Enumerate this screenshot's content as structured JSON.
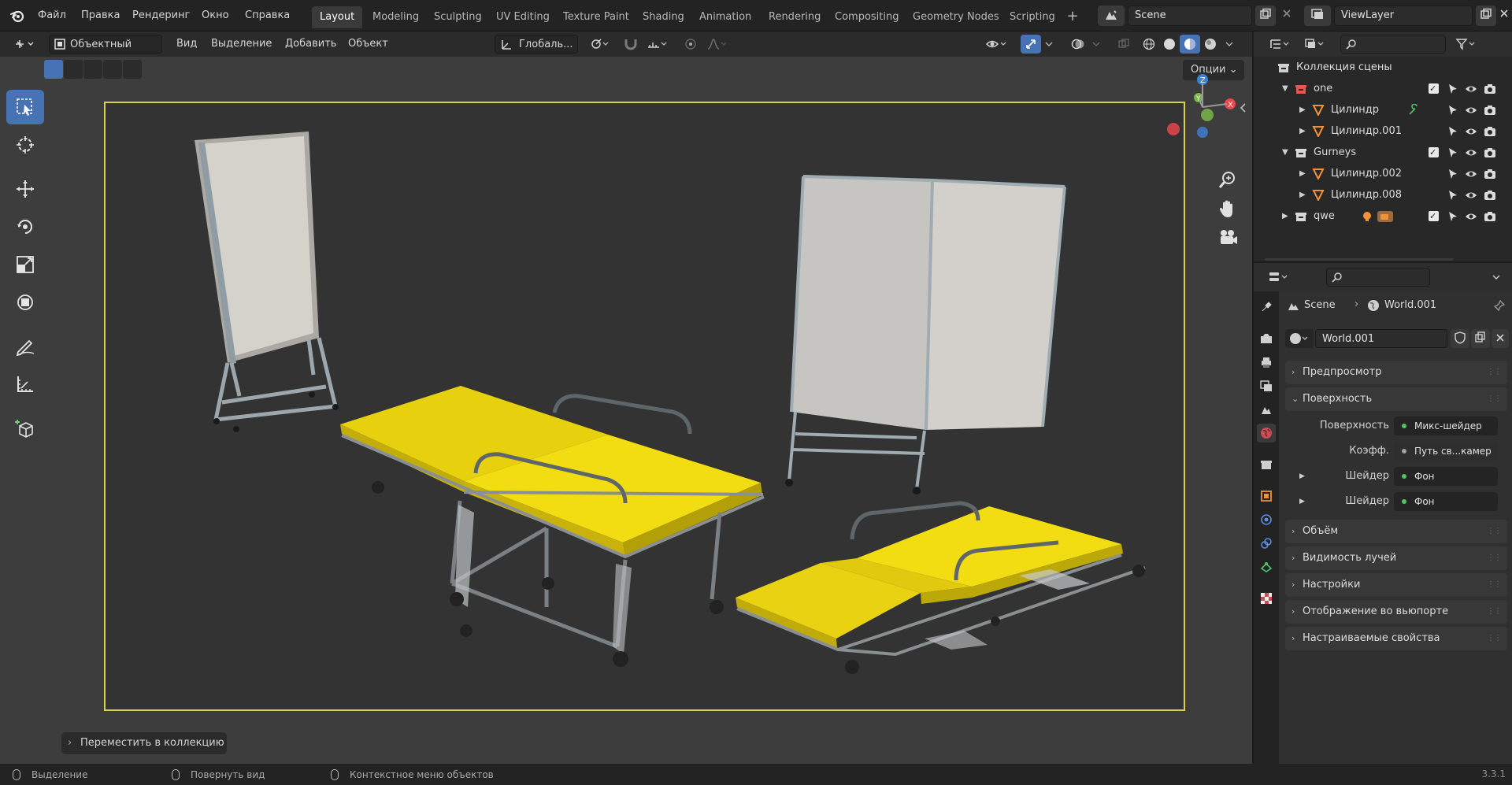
{
  "menu": [
    "Файл",
    "Правка",
    "Рендеринг",
    "Окно",
    "Справка"
  ],
  "workspaces": [
    "Layout",
    "Modeling",
    "Sculpting",
    "UV Editing",
    "Texture Paint",
    "Shading",
    "Animation",
    "Rendering",
    "Compositing",
    "Geometry Nodes",
    "Scripting"
  ],
  "active_workspace": "Layout",
  "scene_name": "Scene",
  "view_layer_name": "ViewLayer",
  "viewport_header": {
    "mode": "Объектный ре...",
    "view": "Вид",
    "select": "Выделение",
    "add": "Добавить",
    "object": "Объект",
    "orientation": "Глобаль...",
    "options": "Опции"
  },
  "redo_panel": "Переместить в коллекцию",
  "status": {
    "left": "Выделение",
    "mid": "Повернуть вид",
    "right": "Контекстное меню объектов",
    "version": "3.3.1"
  },
  "outliner": {
    "root": "Коллекция сцены",
    "rows": [
      {
        "label": "one",
        "type": "collection",
        "color": "#e8574f"
      },
      {
        "label": "Цилиндр",
        "type": "mesh"
      },
      {
        "label": "Цилиндр.001",
        "type": "mesh"
      },
      {
        "label": "Gurneys",
        "type": "collection",
        "color": "#d9d9d9"
      },
      {
        "label": "Цилиндр.002",
        "type": "mesh"
      },
      {
        "label": "Цилиндр.008",
        "type": "mesh"
      },
      {
        "label": "qwe",
        "type": "collection",
        "color": "#d9d9d9"
      }
    ]
  },
  "properties": {
    "breadcrumb_scene": "Scene",
    "breadcrumb_world": "World.001",
    "world_name": "World.001",
    "panels": {
      "preview": "Предпросмотр",
      "surface": "Поверхность",
      "volume": "Объём",
      "ray_visibility": "Видимость лучей",
      "settings": "Настройки",
      "viewport_display": "Отображение во вьюпорте",
      "custom_props": "Настраиваемые свойства"
    },
    "surface_rows": [
      {
        "key": "Поверхность",
        "value": "Микс-шейдер"
      },
      {
        "key": "Коэфф.",
        "value": "Путь св...камер"
      },
      {
        "key": "Шейдер",
        "value": "Фон"
      },
      {
        "key": "Шейдер",
        "value": "Фон"
      }
    ]
  },
  "colors": {
    "accent": "#4772b3",
    "camera_frame": "#d9d14a",
    "mattress": "#f2dc12",
    "x_axis": "#e8474b",
    "y_axis": "#7ab648",
    "z_axis": "#3f7fd9"
  }
}
